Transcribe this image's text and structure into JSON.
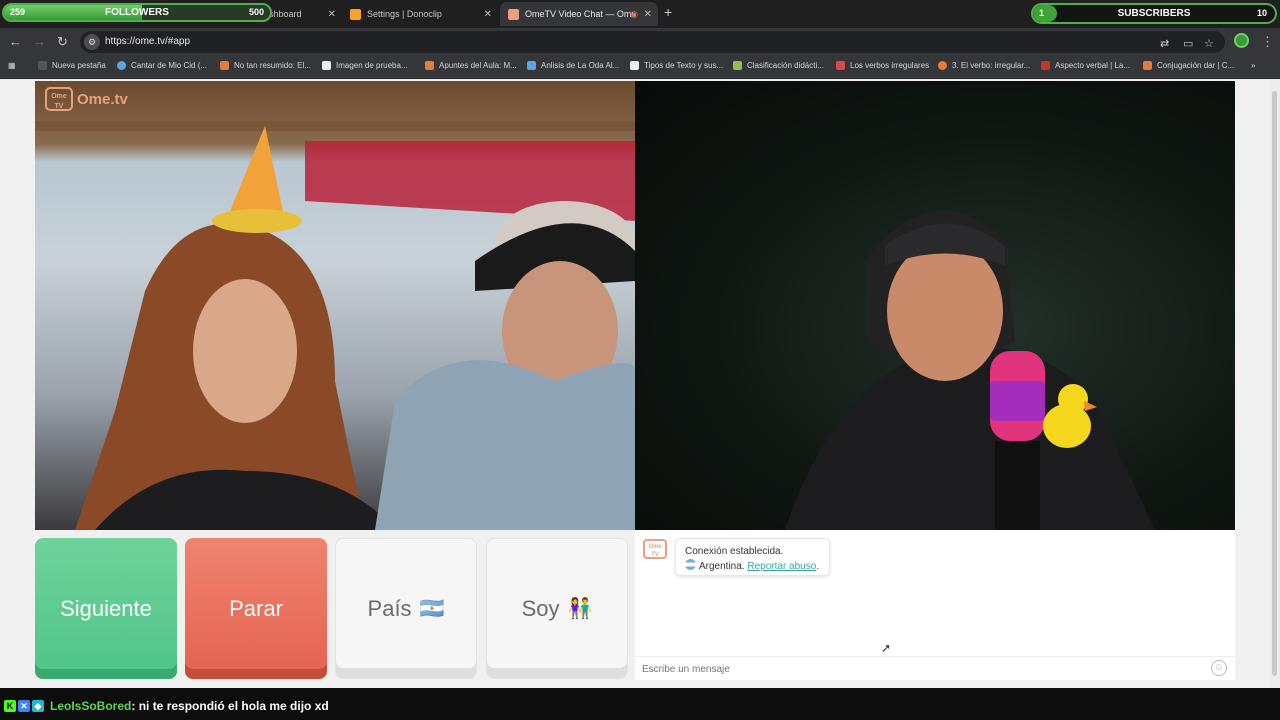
{
  "stream_overlay": {
    "followers": {
      "label": "FOLLOWERS",
      "current": "259",
      "goal": "500",
      "progress": 0.518
    },
    "subscribers": {
      "label": "SUBSCRIBERS",
      "current": "1",
      "goal": "10",
      "progress": 0.1
    }
  },
  "tabs": [
    {
      "label": "Stream - Kick Dashboard",
      "icon": "kick-icon",
      "color": "#53fc18"
    },
    {
      "label": "Settings | Donoclip",
      "icon": "donoclip-icon",
      "color": "#f5a623"
    },
    {
      "label": "OmeTV Video Chat — Ome",
      "icon": "ometv-icon",
      "color": "#e9a07e",
      "active": true
    }
  ],
  "address_bar": {
    "url": "https://ome.tv/#app"
  },
  "bookmarks": [
    "Nueva pestaña",
    "Cantar de Mio Cid (...",
    "No tan resumido: El...",
    "Imagen de prueba...",
    "Apuntes del Aula: M...",
    "Anlisis de La Oda Al...",
    "Tipos de Texto y sus...",
    "Clasificación didácti...",
    "Los verbos irregulares",
    "3. El verbo: irregular...",
    "Aspecto verbal | La...",
    "Conjugación dar | C..."
  ],
  "ometv": {
    "logo_text": "Ome.tv",
    "logo_badge": "Ome TV",
    "buttons": {
      "next": "Siguiente",
      "stop": "Parar",
      "country": "País",
      "country_emoji": "🇦🇷",
      "gender": "Soy",
      "gender_emoji": "👫"
    },
    "chat": {
      "status": "Conexión establecida.",
      "country": "Argentina.",
      "report_link": "Reportar abuso",
      "input_placeholder": "Escribe un mensaje"
    }
  },
  "stream_chat": {
    "username": "LeoIsSoBored",
    "message": ": ni te respondió el hola me dijo xd"
  }
}
